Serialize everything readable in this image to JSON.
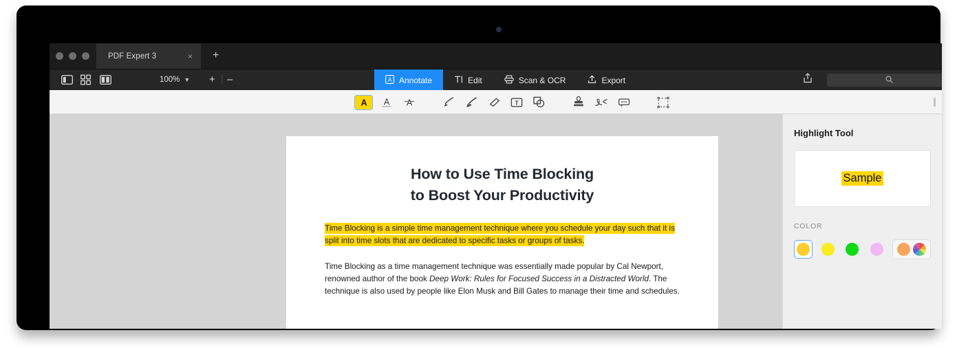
{
  "window": {
    "traffic_lights": [
      "close",
      "minimize",
      "zoom"
    ],
    "tab": {
      "label": "PDF Expert 3",
      "close_icon": "close-icon"
    },
    "new_tab_icon": "plus-icon"
  },
  "toolbar": {
    "view_buttons": [
      {
        "name": "sidebar-toggle",
        "icon": "sidebar-panel-icon"
      },
      {
        "name": "thumbnail-grid",
        "icon": "grid-view-icon"
      },
      {
        "name": "dual-page-view",
        "icon": "dual-page-icon"
      }
    ],
    "zoom_level": "100%",
    "zoom_chevron_icon": "chevron-down-icon",
    "zoom_in_label": "+",
    "zoom_out_label": "–",
    "share_icon": "share-upload-icon",
    "search": {
      "placeholder": "",
      "value": "",
      "icon": "search-icon"
    },
    "mode_tabs": [
      {
        "label": "Annotate",
        "icon": "annotate-a-icon",
        "active": true
      },
      {
        "label": "Edit",
        "icon": "edit-text-icon",
        "active": false
      },
      {
        "label": "Scan & OCR",
        "icon": "scanner-icon",
        "active": false
      },
      {
        "label": "Export",
        "icon": "export-upload-icon",
        "active": false
      }
    ],
    "accent_color": "#1d8bf8"
  },
  "annotation_tools": [
    {
      "name": "highlight-tool",
      "icon": "highlight-a-icon",
      "selected": true
    },
    {
      "name": "underline-tool",
      "icon": "underline-a-icon",
      "selected": false
    },
    {
      "name": "strikethrough-tool",
      "icon": "strikethrough-a-icon",
      "selected": false
    },
    {
      "name": "pen-tool",
      "icon": "pen-icon",
      "selected": false
    },
    {
      "name": "marker-tool",
      "icon": "marker-brush-icon",
      "selected": false
    },
    {
      "name": "eraser-tool",
      "icon": "eraser-icon",
      "selected": false
    },
    {
      "name": "text-box-tool",
      "icon": "text-box-icon",
      "selected": false
    },
    {
      "name": "shapes-tool",
      "icon": "shapes-icon",
      "selected": false
    },
    {
      "name": "stamp-tool",
      "icon": "stamp-icon",
      "selected": false
    },
    {
      "name": "signature-tool",
      "icon": "signature-icon",
      "selected": false
    },
    {
      "name": "comment-tool",
      "icon": "comment-bubble-icon",
      "selected": false
    },
    {
      "name": "area-select-tool",
      "icon": "marquee-select-icon",
      "selected": false
    }
  ],
  "document": {
    "title_line1": "How to Use Time Blocking",
    "title_line2": "to Boost Your Productivity",
    "highlighted_paragraph": "Time Blocking is a simple time management technique where you schedule your day such that it is split into time slots that are dedicated to specific tasks or groups of tasks.",
    "highlight_color": "#ffd60a",
    "body_paragraph_part1": "Time Blocking as a time management technique was essentially made popular by Cal Newport, renowned author of the book ",
    "body_paragraph_italic": "Deep Work: Rules for Focused Success in a Distracted World",
    "body_paragraph_part2": ". The technique is also used by people like Elon Musk and Bill Gates to manage their time and schedules."
  },
  "inspector": {
    "title": "Highlight Tool",
    "sample_text": "Sample",
    "color_label": "COLOR",
    "colors": [
      {
        "name": "golden-yellow",
        "hex": "#fcce2b",
        "selected": true
      },
      {
        "name": "bright-yellow",
        "hex": "#f9ed20",
        "selected": false
      },
      {
        "name": "green",
        "hex": "#10d916",
        "selected": false
      },
      {
        "name": "violet-pink",
        "hex": "#f0b8f5",
        "selected": false
      }
    ],
    "custom": [
      {
        "name": "recent-orange",
        "hex": "#f5a65b"
      },
      {
        "name": "color-wheel",
        "hex": "rainbow"
      }
    ]
  }
}
